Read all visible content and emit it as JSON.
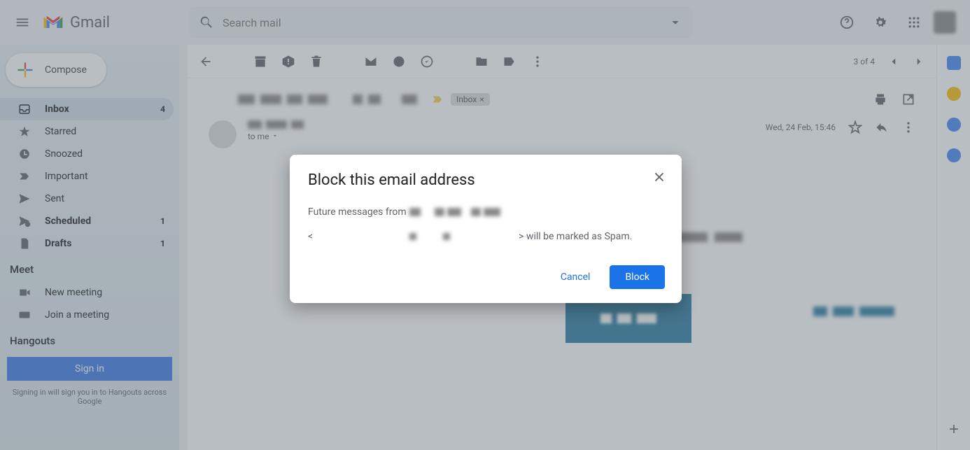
{
  "header": {
    "logo_text": "Gmail",
    "search_placeholder": "Search mail"
  },
  "sidebar": {
    "compose_label": "Compose",
    "items": [
      {
        "label": "Inbox",
        "count": "4"
      },
      {
        "label": "Starred",
        "count": ""
      },
      {
        "label": "Snoozed",
        "count": ""
      },
      {
        "label": "Important",
        "count": ""
      },
      {
        "label": "Sent",
        "count": ""
      },
      {
        "label": "Scheduled",
        "count": "1"
      },
      {
        "label": "Drafts",
        "count": "1"
      }
    ],
    "meet_header": "Meet",
    "meet_items": [
      {
        "label": "New meeting"
      },
      {
        "label": "Join a meeting"
      }
    ],
    "hangouts_header": "Hangouts",
    "signin_label": "Sign in",
    "signin_note": "Signing in will sign you in to Hangouts across Google"
  },
  "toolbar": {
    "position": "3 of 4"
  },
  "message": {
    "inbox_tag": "Inbox",
    "to_line": "to me",
    "date": "Wed, 24 Feb, 15:46"
  },
  "modal": {
    "title": "Block this email address",
    "body_prefix": "Future messages from ",
    "body_mid": "<",
    "body_suffix": "> will be marked as Spam.",
    "cancel_label": "Cancel",
    "block_label": "Block"
  }
}
